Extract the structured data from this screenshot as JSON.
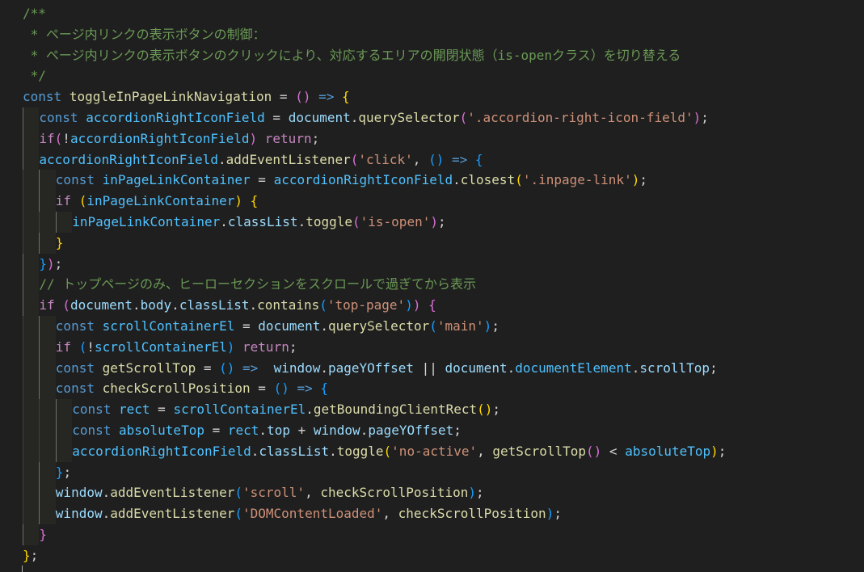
{
  "editor": {
    "language": "javascript",
    "background": "#1f1f1f",
    "colors": {
      "comment": "#6a9955",
      "keyword": "#569cd6",
      "control": "#c586c0",
      "function": "#dcdcaa",
      "variable": "#9cdcfe",
      "constant": "#4fc1ff",
      "string": "#ce9178",
      "bracket_1": "#ffd700",
      "bracket_2": "#da70d6",
      "bracket_3": "#179fff"
    },
    "lines": [
      {
        "indent": 0,
        "tokens": [
          [
            "comment",
            "/**"
          ]
        ]
      },
      {
        "indent": 0,
        "tokens": [
          [
            "comment",
            " * ページ内リンクの表示ボタンの制御："
          ]
        ]
      },
      {
        "indent": 0,
        "tokens": [
          [
            "comment",
            " * ページ内リンクの表示ボタンのクリックにより、対応するエリアの開閉状態（is-openクラス）を切り替える"
          ]
        ]
      },
      {
        "indent": 0,
        "tokens": [
          [
            "comment",
            " */"
          ]
        ]
      },
      {
        "indent": 0,
        "tokens": [
          [
            "keyword",
            "const"
          ],
          [
            "punct",
            " "
          ],
          [
            "function",
            "toggleInPageLinkNavigation"
          ],
          [
            "punct",
            " "
          ],
          [
            "operator",
            "="
          ],
          [
            "punct",
            " "
          ],
          [
            "bracket-2",
            "()"
          ],
          [
            "punct",
            " "
          ],
          [
            "keyword",
            "=>"
          ],
          [
            "punct",
            " "
          ],
          [
            "bracket-1",
            "{"
          ]
        ]
      },
      {
        "indent": 1,
        "tokens": [
          [
            "keyword",
            "const"
          ],
          [
            "punct",
            " "
          ],
          [
            "constant",
            "accordionRightIconField"
          ],
          [
            "punct",
            " "
          ],
          [
            "operator",
            "="
          ],
          [
            "punct",
            " "
          ],
          [
            "variable",
            "document"
          ],
          [
            "punct",
            "."
          ],
          [
            "function",
            "querySelector"
          ],
          [
            "bracket-2",
            "("
          ],
          [
            "string",
            "'.accordion-right-icon-field'"
          ],
          [
            "bracket-2",
            ")"
          ],
          [
            "punct",
            ";"
          ]
        ]
      },
      {
        "indent": 1,
        "tokens": [
          [
            "control",
            "if"
          ],
          [
            "bracket-2",
            "("
          ],
          [
            "operator",
            "!"
          ],
          [
            "constant",
            "accordionRightIconField"
          ],
          [
            "bracket-2",
            ")"
          ],
          [
            "punct",
            " "
          ],
          [
            "control",
            "return"
          ],
          [
            "punct",
            ";"
          ]
        ]
      },
      {
        "indent": 1,
        "tokens": [
          [
            "constant",
            "accordionRightIconField"
          ],
          [
            "punct",
            "."
          ],
          [
            "function",
            "addEventListener"
          ],
          [
            "bracket-2",
            "("
          ],
          [
            "string",
            "'click'"
          ],
          [
            "punct",
            ", "
          ],
          [
            "bracket-3",
            "()"
          ],
          [
            "punct",
            " "
          ],
          [
            "keyword",
            "=>"
          ],
          [
            "punct",
            " "
          ],
          [
            "bracket-3",
            "{"
          ]
        ]
      },
      {
        "indent": 2,
        "tokens": [
          [
            "keyword",
            "const"
          ],
          [
            "punct",
            " "
          ],
          [
            "constant",
            "inPageLinkContainer"
          ],
          [
            "punct",
            " "
          ],
          [
            "operator",
            "="
          ],
          [
            "punct",
            " "
          ],
          [
            "constant",
            "accordionRightIconField"
          ],
          [
            "punct",
            "."
          ],
          [
            "function",
            "closest"
          ],
          [
            "bracket-1",
            "("
          ],
          [
            "string",
            "'.inpage-link'"
          ],
          [
            "bracket-1",
            ")"
          ],
          [
            "punct",
            ";"
          ]
        ]
      },
      {
        "indent": 2,
        "tokens": [
          [
            "control",
            "if"
          ],
          [
            "punct",
            " "
          ],
          [
            "bracket-1",
            "("
          ],
          [
            "constant",
            "inPageLinkContainer"
          ],
          [
            "bracket-1",
            ")"
          ],
          [
            "punct",
            " "
          ],
          [
            "bracket-1",
            "{"
          ]
        ]
      },
      {
        "indent": 3,
        "tokens": [
          [
            "constant",
            "inPageLinkContainer"
          ],
          [
            "punct",
            "."
          ],
          [
            "variable",
            "classList"
          ],
          [
            "punct",
            "."
          ],
          [
            "function",
            "toggle"
          ],
          [
            "bracket-2",
            "("
          ],
          [
            "string",
            "'is-open'"
          ],
          [
            "bracket-2",
            ")"
          ],
          [
            "punct",
            ";"
          ]
        ]
      },
      {
        "indent": 2,
        "tokens": [
          [
            "bracket-1",
            "}"
          ]
        ]
      },
      {
        "indent": 1,
        "tokens": [
          [
            "bracket-3",
            "}"
          ],
          [
            "bracket-2",
            ")"
          ],
          [
            "punct",
            ";"
          ]
        ]
      },
      {
        "indent": 1,
        "tokens": [
          [
            "comment",
            "// トップページのみ、ヒーローセクションをスクロールで過ぎてから表示"
          ]
        ]
      },
      {
        "indent": 1,
        "tokens": [
          [
            "control",
            "if"
          ],
          [
            "punct",
            " "
          ],
          [
            "bracket-2",
            "("
          ],
          [
            "variable",
            "document"
          ],
          [
            "punct",
            "."
          ],
          [
            "variable",
            "body"
          ],
          [
            "punct",
            "."
          ],
          [
            "variable",
            "classList"
          ],
          [
            "punct",
            "."
          ],
          [
            "function",
            "contains"
          ],
          [
            "bracket-3",
            "("
          ],
          [
            "string",
            "'top-page'"
          ],
          [
            "bracket-3",
            ")"
          ],
          [
            "bracket-2",
            ")"
          ],
          [
            "punct",
            " "
          ],
          [
            "bracket-2",
            "{"
          ]
        ]
      },
      {
        "indent": 2,
        "tokens": [
          [
            "keyword",
            "const"
          ],
          [
            "punct",
            " "
          ],
          [
            "constant",
            "scrollContainerEl"
          ],
          [
            "punct",
            " "
          ],
          [
            "operator",
            "="
          ],
          [
            "punct",
            " "
          ],
          [
            "variable",
            "document"
          ],
          [
            "punct",
            "."
          ],
          [
            "function",
            "querySelector"
          ],
          [
            "bracket-3",
            "("
          ],
          [
            "string",
            "'main'"
          ],
          [
            "bracket-3",
            ")"
          ],
          [
            "punct",
            ";"
          ]
        ]
      },
      {
        "indent": 2,
        "tokens": [
          [
            "control",
            "if"
          ],
          [
            "punct",
            " "
          ],
          [
            "bracket-3",
            "("
          ],
          [
            "operator",
            "!"
          ],
          [
            "constant",
            "scrollContainerEl"
          ],
          [
            "bracket-3",
            ")"
          ],
          [
            "punct",
            " "
          ],
          [
            "control",
            "return"
          ],
          [
            "punct",
            ";"
          ]
        ]
      },
      {
        "indent": 2,
        "tokens": [
          [
            "keyword",
            "const"
          ],
          [
            "punct",
            " "
          ],
          [
            "function",
            "getScrollTop"
          ],
          [
            "punct",
            " "
          ],
          [
            "operator",
            "="
          ],
          [
            "punct",
            " "
          ],
          [
            "bracket-3",
            "()"
          ],
          [
            "punct",
            " "
          ],
          [
            "keyword",
            "=>"
          ],
          [
            "punct",
            "  "
          ],
          [
            "variable",
            "window"
          ],
          [
            "punct",
            "."
          ],
          [
            "variable",
            "pageYOffset"
          ],
          [
            "punct",
            " "
          ],
          [
            "operator",
            "||"
          ],
          [
            "punct",
            " "
          ],
          [
            "variable",
            "document"
          ],
          [
            "punct",
            "."
          ],
          [
            "constant",
            "documentElement"
          ],
          [
            "punct",
            "."
          ],
          [
            "variable",
            "scrollTop"
          ],
          [
            "punct",
            ";"
          ]
        ]
      },
      {
        "indent": 2,
        "tokens": [
          [
            "keyword",
            "const"
          ],
          [
            "punct",
            " "
          ],
          [
            "function",
            "checkScrollPosition"
          ],
          [
            "punct",
            " "
          ],
          [
            "operator",
            "="
          ],
          [
            "punct",
            " "
          ],
          [
            "bracket-3",
            "()"
          ],
          [
            "punct",
            " "
          ],
          [
            "keyword",
            "=>"
          ],
          [
            "punct",
            " "
          ],
          [
            "bracket-3",
            "{"
          ]
        ]
      },
      {
        "indent": 3,
        "tokens": [
          [
            "keyword",
            "const"
          ],
          [
            "punct",
            " "
          ],
          [
            "constant",
            "rect"
          ],
          [
            "punct",
            " "
          ],
          [
            "operator",
            "="
          ],
          [
            "punct",
            " "
          ],
          [
            "constant",
            "scrollContainerEl"
          ],
          [
            "punct",
            "."
          ],
          [
            "function",
            "getBoundingClientRect"
          ],
          [
            "bracket-1",
            "()"
          ],
          [
            "punct",
            ";"
          ]
        ]
      },
      {
        "indent": 3,
        "tokens": [
          [
            "keyword",
            "const"
          ],
          [
            "punct",
            " "
          ],
          [
            "constant",
            "absoluteTop"
          ],
          [
            "punct",
            " "
          ],
          [
            "operator",
            "="
          ],
          [
            "punct",
            " "
          ],
          [
            "constant",
            "rect"
          ],
          [
            "punct",
            "."
          ],
          [
            "variable",
            "top"
          ],
          [
            "punct",
            " "
          ],
          [
            "operator",
            "+"
          ],
          [
            "punct",
            " "
          ],
          [
            "variable",
            "window"
          ],
          [
            "punct",
            "."
          ],
          [
            "variable",
            "pageYOffset"
          ],
          [
            "punct",
            ";"
          ]
        ]
      },
      {
        "indent": 3,
        "tokens": [
          [
            "constant",
            "accordionRightIconField"
          ],
          [
            "punct",
            "."
          ],
          [
            "variable",
            "classList"
          ],
          [
            "punct",
            "."
          ],
          [
            "function",
            "toggle"
          ],
          [
            "bracket-1",
            "("
          ],
          [
            "string",
            "'no-active'"
          ],
          [
            "punct",
            ", "
          ],
          [
            "function",
            "getScrollTop"
          ],
          [
            "bracket-2",
            "()"
          ],
          [
            "punct",
            " "
          ],
          [
            "operator",
            "<"
          ],
          [
            "punct",
            " "
          ],
          [
            "constant",
            "absoluteTop"
          ],
          [
            "bracket-1",
            ")"
          ],
          [
            "punct",
            ";"
          ]
        ]
      },
      {
        "indent": 2,
        "tokens": [
          [
            "bracket-3",
            "}"
          ],
          [
            "punct",
            ";"
          ]
        ]
      },
      {
        "indent": 2,
        "tokens": [
          [
            "variable",
            "window"
          ],
          [
            "punct",
            "."
          ],
          [
            "function",
            "addEventListener"
          ],
          [
            "bracket-3",
            "("
          ],
          [
            "string",
            "'scroll'"
          ],
          [
            "punct",
            ", "
          ],
          [
            "function",
            "checkScrollPosition"
          ],
          [
            "bracket-3",
            ")"
          ],
          [
            "punct",
            ";"
          ]
        ]
      },
      {
        "indent": 2,
        "tokens": [
          [
            "variable",
            "window"
          ],
          [
            "punct",
            "."
          ],
          [
            "function",
            "addEventListener"
          ],
          [
            "bracket-3",
            "("
          ],
          [
            "string",
            "'DOMContentLoaded'"
          ],
          [
            "punct",
            ", "
          ],
          [
            "function",
            "checkScrollPosition"
          ],
          [
            "bracket-3",
            ")"
          ],
          [
            "punct",
            ";"
          ]
        ]
      },
      {
        "indent": 1,
        "tokens": [
          [
            "bracket-2",
            "}"
          ]
        ]
      },
      {
        "indent": 0,
        "tokens": [
          [
            "bracket-1",
            "}"
          ],
          [
            "punct",
            ";"
          ]
        ]
      }
    ]
  }
}
